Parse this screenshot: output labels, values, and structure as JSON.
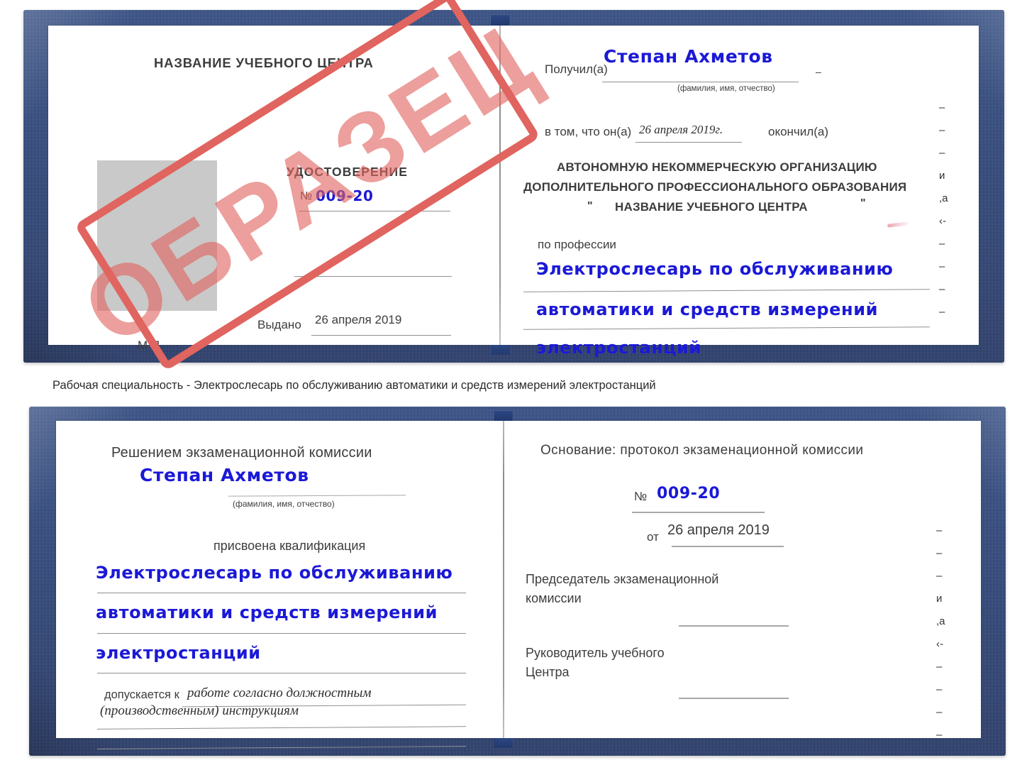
{
  "document": {
    "type": "certificate-booklet-sample",
    "watermark_text": "ОБРАЗЕЦ",
    "watermark_color": "#e0645f",
    "handwriting_color": "#1b19d6",
    "cover_color": "#26407a"
  },
  "caption": {
    "text": "Рабочая специальность - Электрослесарь по обслуживанию автоматики и средств измерений электростанций"
  },
  "top_certificate": {
    "left_page": {
      "org_title": "НАЗВАНИЕ УЧЕБНОГО ЦЕНТРА",
      "doc_type": "УДОСТОВЕРЕНИЕ",
      "number_label": "№",
      "number_value": "009-20",
      "issued_label": "Выдано",
      "issued_value": "26 апреля 2019",
      "seal_label": "М.П."
    },
    "right_page": {
      "received_label": "Получил(а)",
      "received_value": "Степан Ахметов",
      "name_hint": "(фамилия, имя, отчество)",
      "in_that_label": "в том, что он(а)",
      "completion_date": "26 апреля 2019г.",
      "graduated_label": "окончил(а)",
      "org_line_1": "АВТОНОМНУЮ НЕКОММЕРЧЕСКУЮ ОРГАНИЗАЦИЮ",
      "org_line_2": "ДОПОЛНИТЕЛЬНОГО ПРОФЕССИОНАЛЬНОГО ОБРАЗОВАНИЯ",
      "org_line_3_quote_open": "\"",
      "org_line_3": "НАЗВАНИЕ УЧЕБНОГО ЦЕНТРА",
      "org_line_3_quote_close": "\"",
      "profession_label": "по профессии",
      "profession_line_1": "Электрослесарь по обслуживанию",
      "profession_line_2": "автоматики и средств измерений",
      "profession_line_3": "электростанций",
      "edge_marks": [
        "–",
        "–",
        "–",
        "и",
        ",а",
        "‹-",
        "–",
        "–",
        "–",
        "–"
      ]
    }
  },
  "bottom_certificate": {
    "left_page": {
      "commission_heading": "Решением экзаменационной комиссии",
      "name_value": "Степан Ахметов",
      "name_hint": "(фамилия, имя, отчество)",
      "qualification_label": "присвоена квалификация",
      "qualification_line_1": "Электрослесарь по обслуживанию",
      "qualification_line_2": "автоматики и средств измерений",
      "qualification_line_3": "электростанций",
      "admitted_label": "допускается к",
      "admitted_value_1": "работе согласно должностным",
      "admitted_value_2": "(производственным) инструкциям"
    },
    "right_page": {
      "basis_label": "Основание: протокол экзаменационной комиссии",
      "number_label": "№",
      "number_value": "009-20",
      "date_label": "от",
      "date_value": "26 апреля 2019",
      "chairman_line_1": "Председатель экзаменационной",
      "chairman_line_2": "комиссии",
      "head_line_1": "Руководитель учебного",
      "head_line_2": "Центра",
      "edge_marks": [
        "–",
        "–",
        "–",
        "и",
        ",а",
        "‹-",
        "–",
        "–",
        "–",
        "–"
      ]
    }
  }
}
